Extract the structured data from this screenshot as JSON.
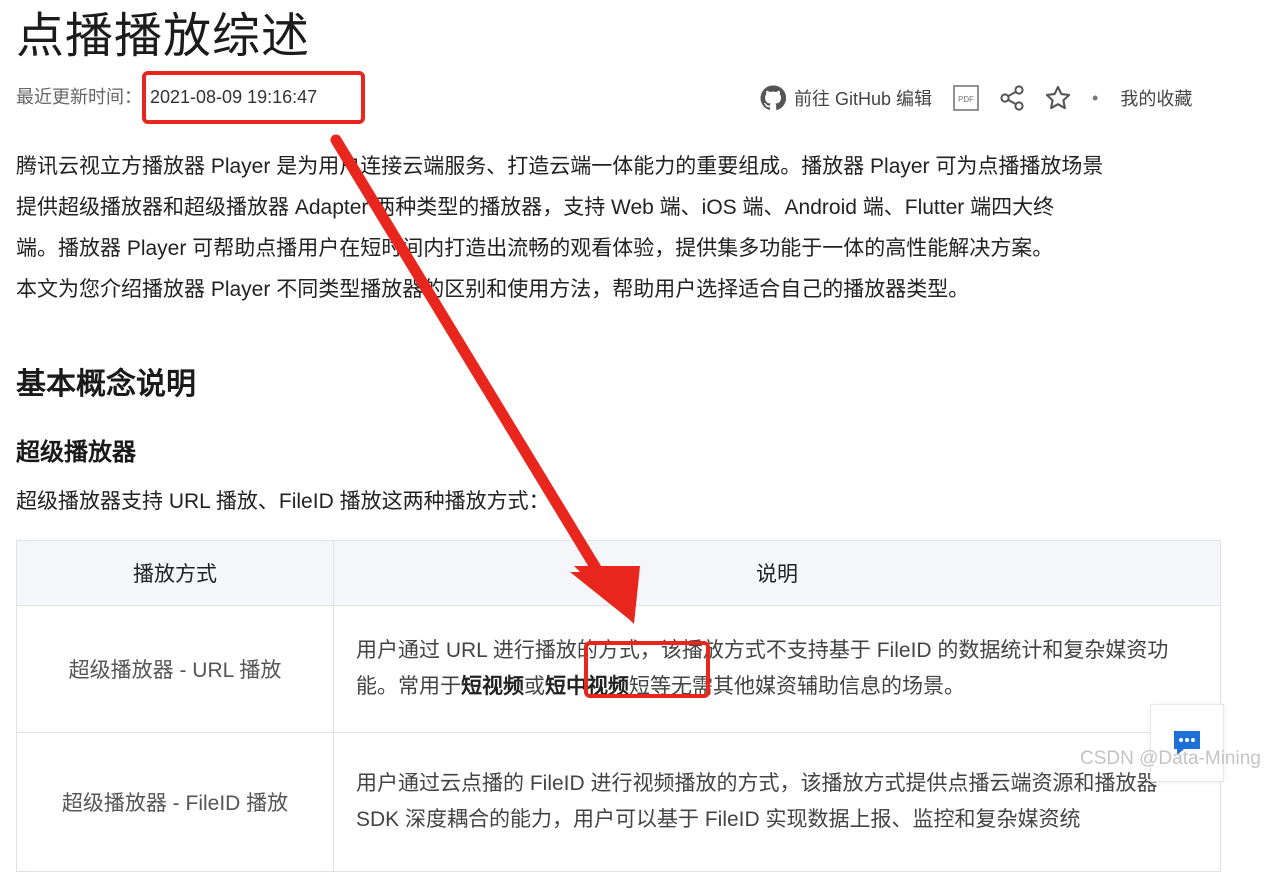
{
  "page": {
    "title": "点播播放综述",
    "updated_label": "最近更新时间：",
    "updated_time": "2021-08-09 19:16:47"
  },
  "actions": {
    "github_label": "前往 GitHub 编辑",
    "pdf_label": "PDF",
    "favorites_label": "我的收藏",
    "dot": "•"
  },
  "intro": {
    "line1": "腾讯云视立方播放器 Player 是为用户连接云端服务、打造云端一体能力的重要组成。播放器 Player 可为点播播放场景",
    "line2": "提供超级播放器和超级播放器 Adapter 两种类型的播放器，支持 Web 端、iOS 端、Android 端、Flutter 端四大终",
    "line3": "端。播放器 Player 可帮助点播用户在短时间内打造出流畅的观看体验，提供集多功能于一体的高性能解决方案。",
    "line4": "本文为您介绍播放器 Player 不同类型播放器的区别和使用方法，帮助用户选择适合自己的播放器类型。"
  },
  "section": {
    "heading": "基本概念说明",
    "subheading": "超级播放器",
    "desc": "超级播放器支持 URL 播放、FileID 播放这两种播放方式："
  },
  "table": {
    "headers": [
      "播放方式",
      "说明"
    ],
    "row1": {
      "name": "超级播放器 - URL 播放",
      "text_a": "用户通过 URL 进行播放的方式，该播放方式不支持基于 FileID 的数据统计和复杂媒资功能。常用于",
      "bold1": "短视频",
      "text_b": "或",
      "bold2": "短中视频",
      "text_c": "短等无需其他媒资辅助信息的场景。"
    },
    "row2": {
      "name": "超级播放器 - FileID 播放",
      "text": "用户通过云点播的 FileID 进行视频播放的方式，该播放方式提供点播云端资源和播放器 SDK 深度耦合的能力，用户可以基于 FileID 实现数据上报、监控和复杂媒资统"
    }
  },
  "watermark": "CSDN @Data-Mining",
  "colors": {
    "annotation_red": "#e8261e",
    "table_header_bg": "#f4f6fa",
    "chat_icon_blue": "#1f6fd9"
  },
  "icons": [
    "github-icon",
    "pdf-icon",
    "share-icon",
    "star-icon",
    "chat-icon"
  ]
}
